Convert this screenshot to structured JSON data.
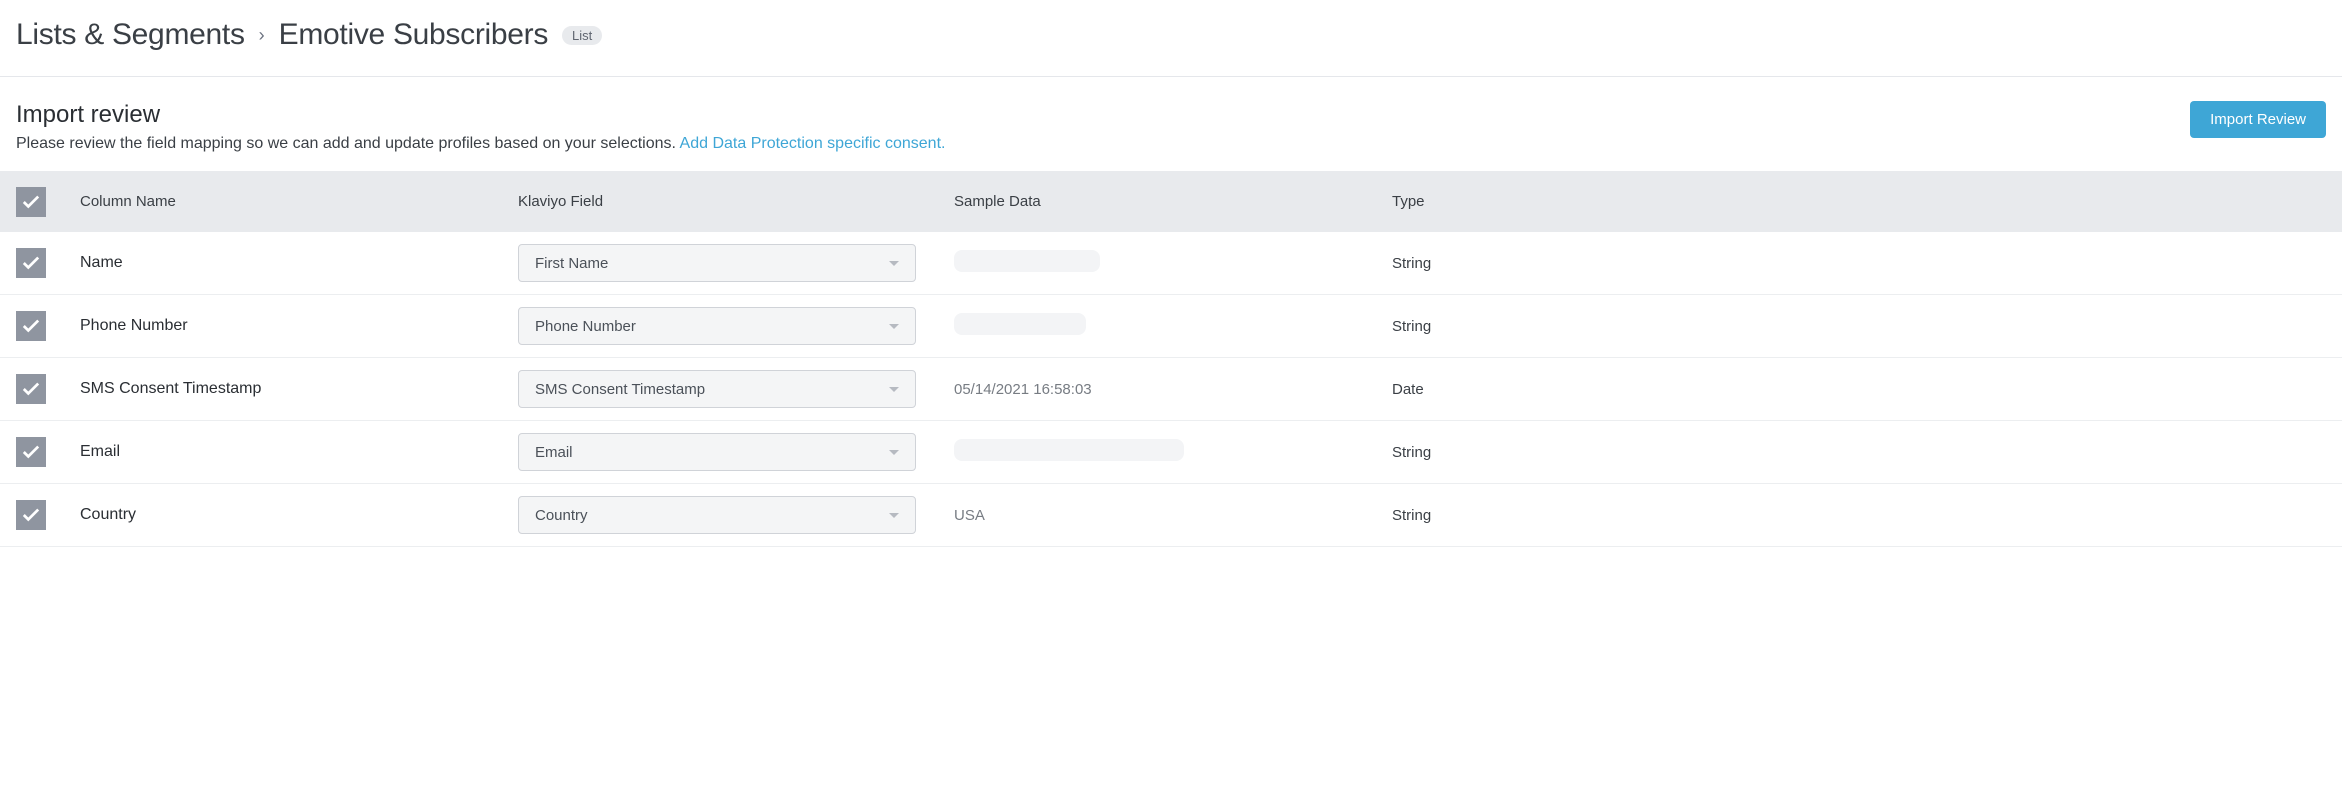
{
  "breadcrumb": {
    "parent": "Lists & Segments",
    "sep_glyph": "›",
    "title": "Emotive Subscribers",
    "badge": "List"
  },
  "subheader": {
    "heading": "Import review",
    "description": "Please review the field mapping so we can add and update profiles based on your selections.",
    "consent_link": "Add Data Protection specific consent.",
    "button": "Import Review"
  },
  "columns": {
    "name": "Column Name",
    "field": "Klaviyo Field",
    "sample": "Sample Data",
    "type": "Type"
  },
  "rows": [
    {
      "name": "Name",
      "field": "First Name",
      "sample": "",
      "redacted_w": 146,
      "type": "String"
    },
    {
      "name": "Phone Number",
      "field": "Phone Number",
      "sample": "",
      "redacted_w": 132,
      "type": "String"
    },
    {
      "name": "SMS Consent Timestamp",
      "field": "SMS Consent Timestamp",
      "sample": "05/14/2021 16:58:03",
      "redacted_w": 0,
      "type": "Date"
    },
    {
      "name": "Email",
      "field": "Email",
      "sample": "",
      "redacted_w": 230,
      "type": "String"
    },
    {
      "name": "Country",
      "field": "Country",
      "sample": "USA",
      "redacted_w": 0,
      "type": "String"
    }
  ]
}
